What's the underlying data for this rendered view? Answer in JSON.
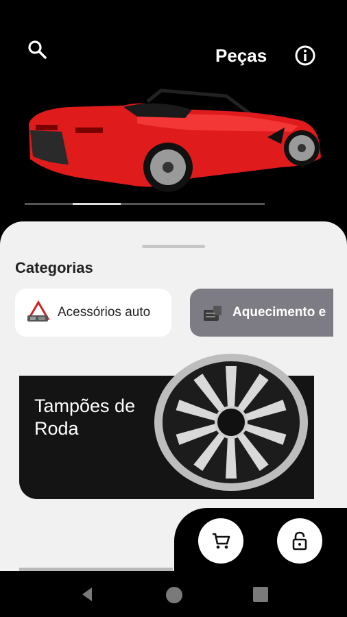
{
  "header": {
    "title": "Peças",
    "search_icon": "search-icon",
    "info_icon": "info-icon"
  },
  "hero": {
    "image": "red-convertible-car",
    "carousel_active_index": 1,
    "carousel_count": 5
  },
  "categories": {
    "title": "Categorias",
    "items": [
      {
        "label": "Acessórios auto",
        "icon": "warning-triangle-kit-icon"
      },
      {
        "label": "Aquecimento e",
        "icon": "heater-icon"
      }
    ]
  },
  "promo": {
    "title": "Tampões de Roda",
    "image": "wheel-cover"
  },
  "actions": {
    "cart_icon": "cart-icon",
    "lock_icon": "lock-open-icon"
  },
  "colors": {
    "background": "#000000",
    "sheet": "#f1f1f1",
    "chip_active": "#ffffff",
    "chip_inactive": "#7d7c85",
    "car_red": "#e01b1b"
  }
}
